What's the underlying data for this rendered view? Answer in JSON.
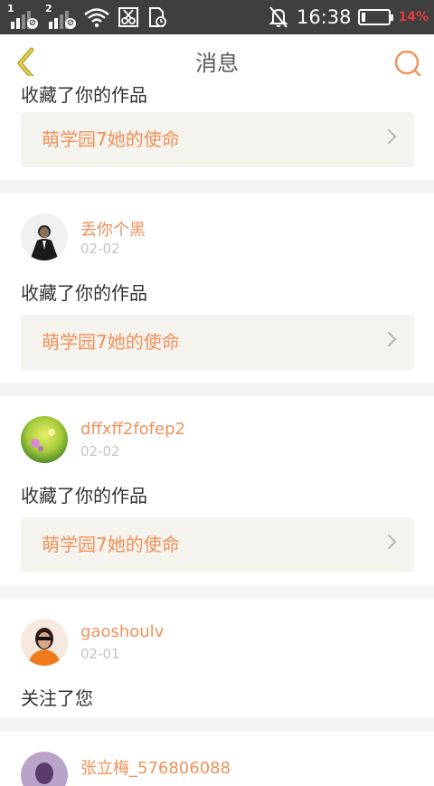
{
  "status_bar": {
    "sim1": "1",
    "sim2": "2",
    "time": "16:38",
    "battery": "14%"
  },
  "header": {
    "title": "消息",
    "back_icon": "chevron-left-icon",
    "search_icon": "search-icon"
  },
  "messages": [
    {
      "user": "",
      "date": "",
      "action": "收藏了你的作品",
      "work": "萌学园7她的使命"
    },
    {
      "user": "丢你个黑",
      "date": "02-02",
      "action": "收藏了你的作品",
      "work": "萌学园7她的使命"
    },
    {
      "user": "dffxff2fofep2",
      "date": "02-02",
      "action": "收藏了你的作品",
      "work": "萌学园7她的使命"
    },
    {
      "user": "gaoshoulv",
      "date": "02-01",
      "action": "关注了您"
    },
    {
      "user": "张立梅_576806088"
    }
  ],
  "colors": {
    "accent": "#f0915a",
    "status_bar_bg": "#3f3f3f",
    "work_box_bg": "#f5f3ed"
  }
}
